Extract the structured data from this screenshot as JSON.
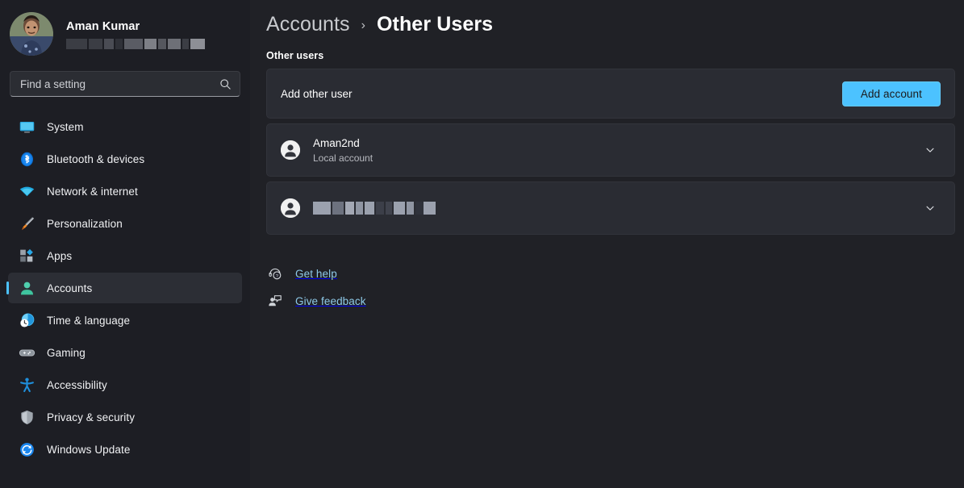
{
  "profile": {
    "name": "Aman Kumar",
    "email_redacted": true,
    "avatar_icon": "user-photo-avatar",
    "redaction_blocks": [
      {
        "width": 26,
        "color": "#3b3d44"
      },
      {
        "width": 17,
        "color": "#3b3d44"
      },
      {
        "width": 12,
        "color": "#4a4c54"
      },
      {
        "width": 9,
        "color": "#2f3138"
      },
      {
        "width": 23,
        "color": "#5a5c64"
      },
      {
        "width": 15,
        "color": "#7d7f86"
      },
      {
        "width": 10,
        "color": "#55575e"
      },
      {
        "width": 16,
        "color": "#6e7077"
      },
      {
        "width": 8,
        "color": "#3b3d44"
      },
      {
        "width": 18,
        "color": "#8d8f96"
      }
    ]
  },
  "search": {
    "placeholder": "Find a setting",
    "icon": "search-icon"
  },
  "sidebar": {
    "items": [
      {
        "label": "System",
        "icon": "system-icon",
        "selected": false
      },
      {
        "label": "Bluetooth & devices",
        "icon": "bluetooth-icon",
        "selected": false
      },
      {
        "label": "Network & internet",
        "icon": "network-icon",
        "selected": false
      },
      {
        "label": "Personalization",
        "icon": "personalization-icon",
        "selected": false
      },
      {
        "label": "Apps",
        "icon": "apps-icon",
        "selected": false
      },
      {
        "label": "Accounts",
        "icon": "accounts-icon",
        "selected": true
      },
      {
        "label": "Time & language",
        "icon": "time-language-icon",
        "selected": false
      },
      {
        "label": "Gaming",
        "icon": "gaming-icon",
        "selected": false
      },
      {
        "label": "Accessibility",
        "icon": "accessibility-icon",
        "selected": false
      },
      {
        "label": "Privacy & security",
        "icon": "privacy-security-icon",
        "selected": false
      },
      {
        "label": "Windows Update",
        "icon": "windows-update-icon",
        "selected": false
      }
    ]
  },
  "header": {
    "breadcrumb_root": "Accounts",
    "breadcrumb_separator": "›",
    "breadcrumb_current": "Other Users"
  },
  "main": {
    "section_label": "Other users",
    "add_user": {
      "label": "Add other user",
      "button_label": "Add account"
    },
    "users": [
      {
        "name": "Aman2nd",
        "subtitle": "Local account",
        "redacted": false,
        "chevron": "chevron-down-icon"
      },
      {
        "name": "",
        "subtitle": "",
        "redacted": true,
        "chevron": "chevron-down-icon",
        "redaction_blocks": [
          {
            "width": 22,
            "color": "#9ba1ae"
          },
          {
            "width": 14,
            "color": "#6d727f"
          },
          {
            "width": 11,
            "color": "#a3a8b4"
          },
          {
            "width": 9,
            "color": "#8f95a2"
          },
          {
            "width": 12,
            "color": "#9ba1ae"
          },
          {
            "width": 10,
            "color": "#3c3f49"
          },
          {
            "width": 8,
            "color": "#40434d"
          },
          {
            "width": 14,
            "color": "#9ba1ae"
          },
          {
            "width": 9,
            "color": "#8f95a2"
          },
          {
            "width": 10,
            "color": "#2f323b"
          }
        ],
        "redaction_blocks_2": [
          {
            "width": 15,
            "color": "#9ba1ae"
          }
        ]
      }
    ],
    "footer_links": [
      {
        "label": "Get help",
        "icon": "get-help-icon"
      },
      {
        "label": "Give feedback",
        "icon": "give-feedback-icon"
      }
    ]
  },
  "colors": {
    "accent": "#4cc2ff",
    "link": "#8ec9e8",
    "sidebar_bg": "#1d1e24",
    "main_bg": "#202126",
    "card_bg": "#2a2c33",
    "selected_bg": "#2c2e35"
  }
}
